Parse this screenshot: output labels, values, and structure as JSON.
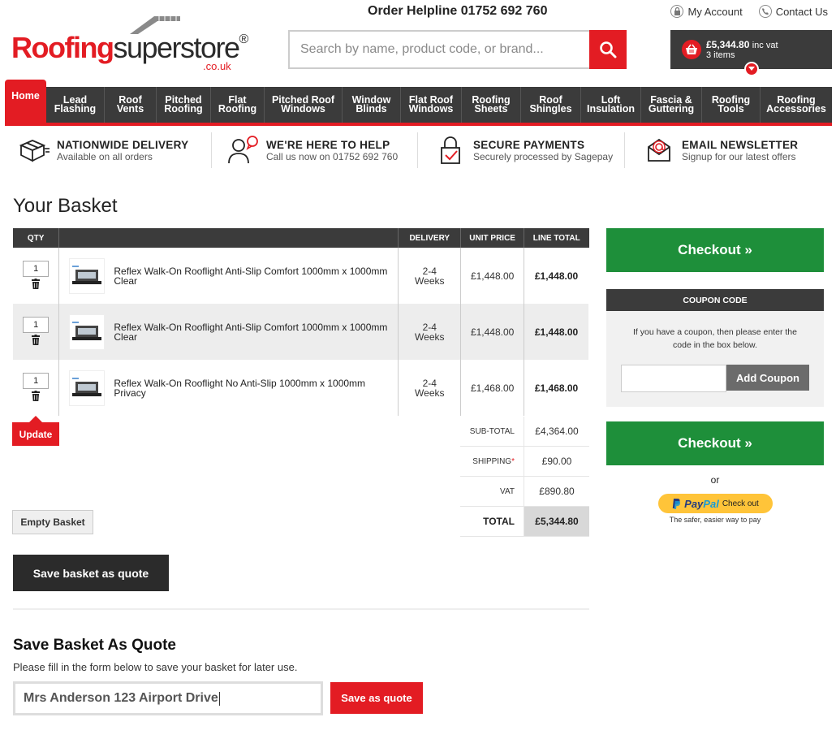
{
  "header": {
    "logo_red": "Roofing",
    "logo_grey": "superstore",
    "logo_reg": "®",
    "logo_couk": ".co.uk",
    "helpline": "Order Helpline 01752 692 760",
    "my_account": "My Account",
    "contact_us": "Contact Us",
    "search_placeholder": "Search by name, product code, or brand...",
    "basket_total": "£5,344.80",
    "basket_vat": "inc vat",
    "basket_items": "3 items"
  },
  "nav": [
    {
      "label": "Home"
    },
    {
      "label": "Lead Flashing"
    },
    {
      "label": "Roof Vents"
    },
    {
      "label": "Pitched Roofing"
    },
    {
      "label": "Flat Roofing"
    },
    {
      "label": "Pitched Roof Windows"
    },
    {
      "label": "Window Blinds"
    },
    {
      "label": "Flat Roof Windows"
    },
    {
      "label": "Roofing Sheets"
    },
    {
      "label": "Roof Shingles"
    },
    {
      "label": "Loft Insulation"
    },
    {
      "label": "Fascia & Guttering"
    },
    {
      "label": "Roofing Tools"
    },
    {
      "label": "Roofing Accessories"
    }
  ],
  "usp": [
    {
      "title": "NATIONWIDE DELIVERY",
      "sub": "Available on all orders"
    },
    {
      "title": "WE'RE HERE TO HELP",
      "sub": "Call us now on 01752 692 760"
    },
    {
      "title": "SECURE PAYMENTS",
      "sub": "Securely processed by Sagepay"
    },
    {
      "title": "EMAIL NEWSLETTER",
      "sub": "Signup for our latest offers"
    }
  ],
  "basket": {
    "title": "Your Basket",
    "columns": {
      "qty": "QTY",
      "delivery": "DELIVERY",
      "unit_price": "UNIT PRICE",
      "line_total": "LINE TOTAL"
    },
    "items": [
      {
        "qty": "1",
        "name": "Reflex Walk-On Rooflight Anti-Slip Comfort 1000mm x 1000mm Clear",
        "delivery_1": "2-4",
        "delivery_2": "Weeks",
        "unit_price": "£1,448.00",
        "line_total": "£1,448.00"
      },
      {
        "qty": "1",
        "name": "Reflex Walk-On Rooflight Anti-Slip Comfort 1000mm x 1000mm Clear",
        "delivery_1": "2-4",
        "delivery_2": "Weeks",
        "unit_price": "£1,448.00",
        "line_total": "£1,448.00"
      },
      {
        "qty": "1",
        "name": "Reflex Walk-On Rooflight No Anti-Slip 1000mm x 1000mm Privacy",
        "delivery_1": "2-4",
        "delivery_2": "Weeks",
        "unit_price": "£1,468.00",
        "line_total": "£1,468.00"
      }
    ],
    "update_label": "Update",
    "empty_label": "Empty Basket",
    "subtotal_label": "SUB-TOTAL",
    "subtotal": "£4,364.00",
    "shipping_label": "SHIPPING",
    "shipping_star": "*",
    "shipping": "£90.00",
    "vat_label": "VAT",
    "vat": "£890.80",
    "total_label": "TOTAL",
    "total": "£5,344.80",
    "save_quote_label": "Save basket as quote"
  },
  "quote": {
    "title": "Save Basket As Quote",
    "subtitle": "Please fill in the form below to save your basket for later use.",
    "input_value": "Mrs Anderson 123 Airport Drive",
    "save_label": "Save as quote"
  },
  "sidebar": {
    "checkout_label": "Checkout »",
    "coupon_title": "COUPON CODE",
    "coupon_text": "If you have a coupon, then please enter the code in the box below.",
    "add_coupon_label": "Add Coupon",
    "or_label": "or",
    "paypal_pay": "Pay",
    "paypal_pal": "Pal",
    "paypal_checkout": "Check out",
    "paypal_tagline": "The safer, easier way to pay"
  },
  "colors": {
    "brand_red": "#e31c23",
    "dark": "#3b3b3b",
    "checkout_green": "#1e8f3a",
    "paypal_yellow": "#ffc439"
  }
}
